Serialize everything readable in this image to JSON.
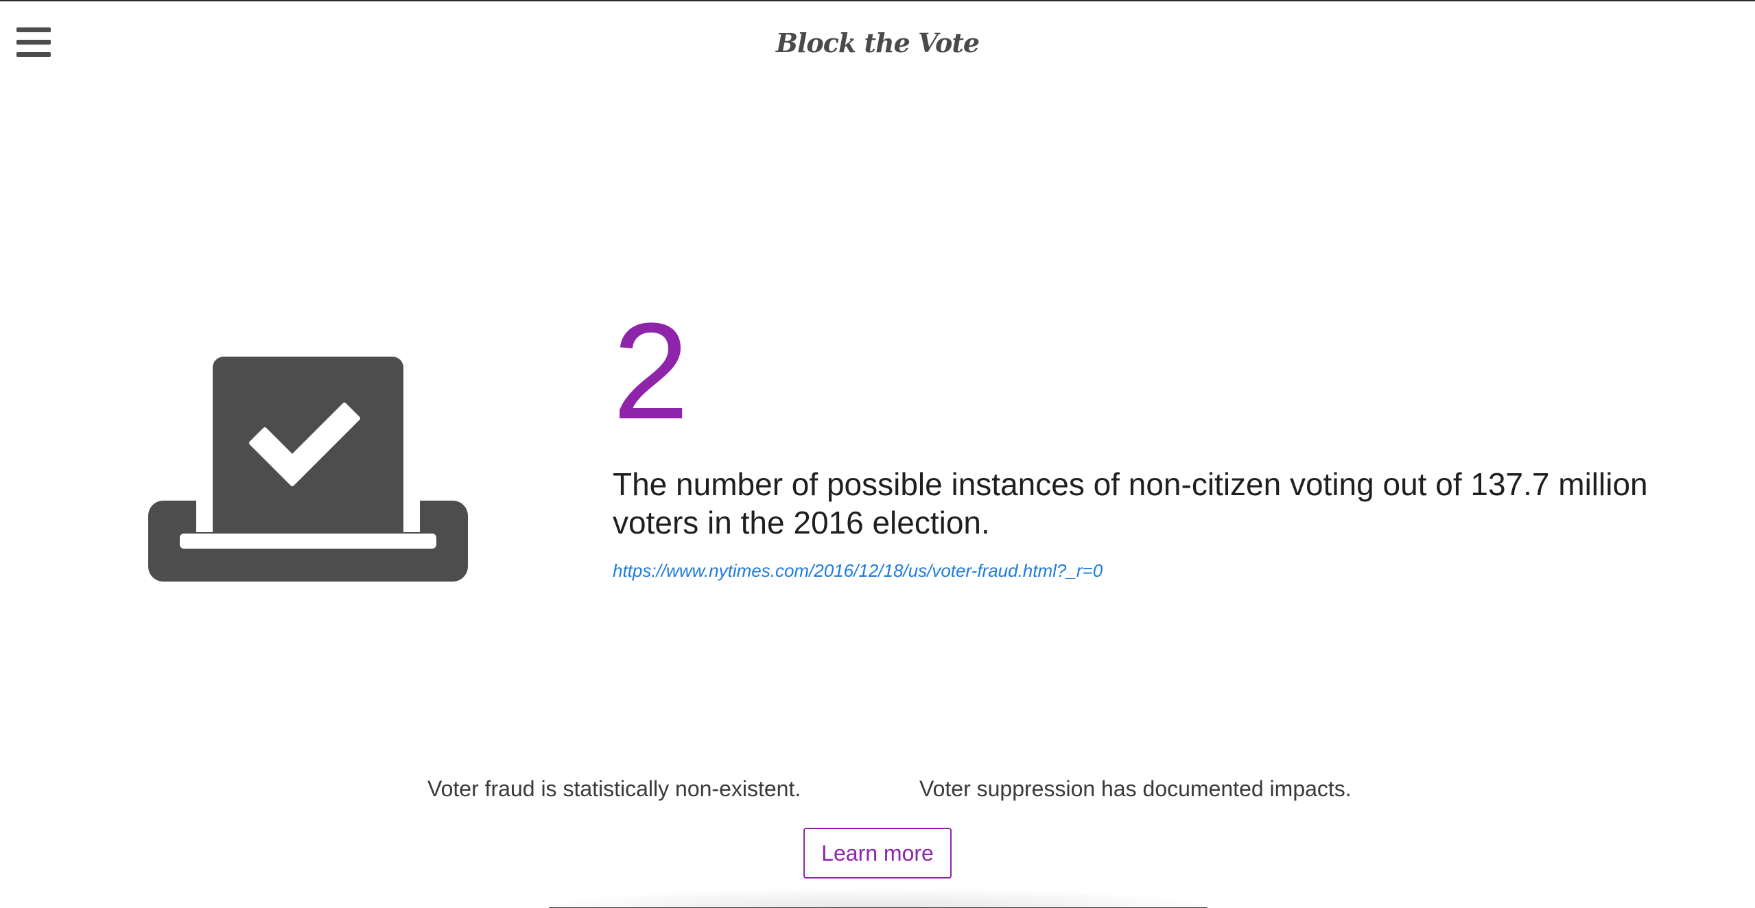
{
  "header": {
    "menu_icon": "hamburger-menu-icon",
    "title": "Block the Vote"
  },
  "hero": {
    "icon": "ballot-box-checkmark-icon",
    "number": "2",
    "description": "The number of possible instances of non-citizen voting out of 137.7 million voters in the 2016 election.",
    "source_link": "https://www.nytimes.com/2016/12/18/us/voter-fraud.html?_r=0"
  },
  "claims": {
    "left": "Voter fraud is statistically non-existent.",
    "right": "Voter suppression has documented impacts."
  },
  "cta": {
    "learn_more_label": "Learn more"
  },
  "colors": {
    "accent": "#8e24aa",
    "icon_gray": "#4d4d4d",
    "link": "#1e7be0",
    "text": "#1f1f1f"
  }
}
